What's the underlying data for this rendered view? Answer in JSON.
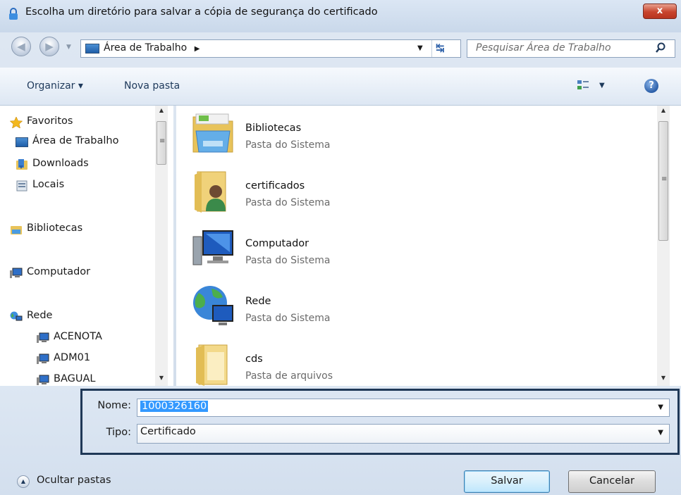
{
  "window": {
    "title": "Escolha um diretório para salvar a cópia de segurança do certificado",
    "close_label": "x"
  },
  "address": {
    "path_label": "Área de Trabalho",
    "separator": "▶",
    "search_placeholder": "Pesquisar Área de Trabalho"
  },
  "toolbar": {
    "organize_label": "Organizar ▾",
    "new_folder_label": "Nova pasta"
  },
  "nav": {
    "favorites": "Favoritos",
    "desktop": "Área de Trabalho",
    "downloads": "Downloads",
    "places": "Locais",
    "libraries": "Bibliotecas",
    "computer": "Computador",
    "network": "Rede",
    "hosts": [
      "ACENOTA",
      "ADM01",
      "BAGUAL"
    ]
  },
  "files": [
    {
      "name": "Bibliotecas",
      "type": "Pasta do Sistema",
      "icon": "libraries-icon"
    },
    {
      "name": "certificados",
      "type": "Pasta do Sistema",
      "icon": "user-folder-icon"
    },
    {
      "name": "Computador",
      "type": "Pasta do Sistema",
      "icon": "computer-icon"
    },
    {
      "name": "Rede",
      "type": "Pasta do Sistema",
      "icon": "network-icon"
    },
    {
      "name": "cds",
      "type": "Pasta de arquivos",
      "icon": "folder-icon"
    }
  ],
  "form": {
    "name_label": "Nome:",
    "name_value": "1000326160",
    "type_label": "Tipo:",
    "type_value": "Certificado"
  },
  "footer": {
    "hide_folders_label": "Ocultar pastas",
    "save_label": "Salvar",
    "cancel_label": "Cancelar"
  },
  "colors": {
    "selection": "#3399ff",
    "highlight_border": "#1f3857",
    "close_button": "#c8442d"
  }
}
